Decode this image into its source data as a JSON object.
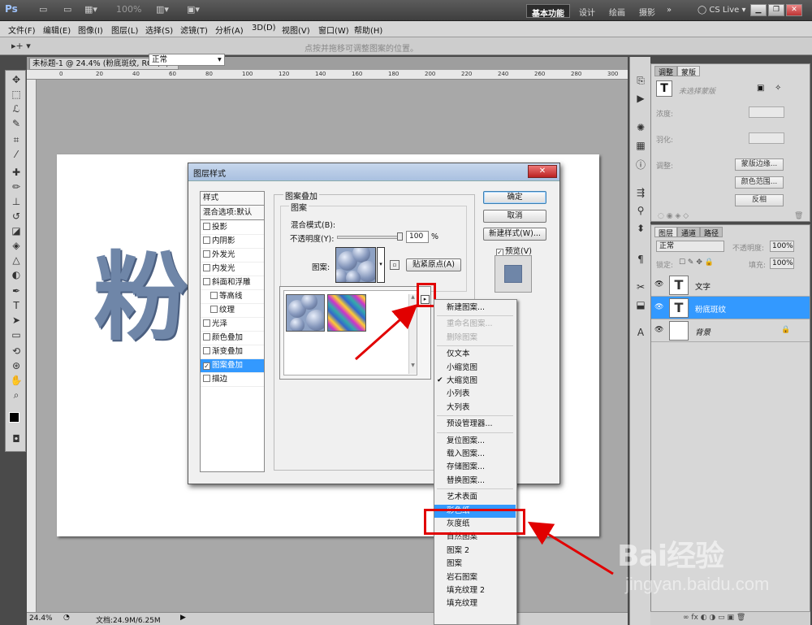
{
  "app": {
    "logo": "Ps",
    "zoom_dropdown": "100%",
    "workspaces": [
      "基本功能",
      "设计",
      "绘画",
      "摄影",
      "»"
    ],
    "cs_live": "CS Live"
  },
  "menus": [
    "文件(F)",
    "编辑(E)",
    "图像(I)",
    "图层(L)",
    "选择(S)",
    "滤镜(T)",
    "分析(A)",
    "3D(D)",
    "视图(V)",
    "窗口(W)",
    "帮助(H)"
  ],
  "options_bar": {
    "hint": "点按并拖移可调整图案的位置。"
  },
  "document": {
    "tab_title": "未标题-1 @ 24.4% (粉底斑纹, RGB/8) *",
    "ruler_ticks": [
      "0",
      "20",
      "40",
      "60",
      "80",
      "100",
      "120",
      "140",
      "160",
      "180",
      "200",
      "220",
      "240",
      "260",
      "280",
      "300"
    ],
    "canvas_text": "粉",
    "status_zoom": "24.4%",
    "status_doc": "文档:24.9M/6.25M"
  },
  "adjust_panel": {
    "tabs": [
      "调整",
      "蒙版"
    ],
    "no_mask": "未选择蒙版",
    "density": "浓度:",
    "feather": "羽化:",
    "refine": "调整:",
    "btn_edge": "蒙版边缘...",
    "btn_color_range": "颜色范围...",
    "btn_invert": "反相"
  },
  "layers_panel": {
    "tabs": [
      "图层",
      "通道",
      "路径"
    ],
    "blend": "正常",
    "opacity_label": "不透明度:",
    "opacity": "100%",
    "lock_label": "锁定:",
    "fill_label": "填充:",
    "fill": "100%",
    "layers": [
      {
        "name": "文字",
        "thumb": "T",
        "selected": false
      },
      {
        "name": "粉底斑纹",
        "thumb": "T",
        "selected": true
      },
      {
        "name": "背景",
        "thumb": "",
        "selected": false
      }
    ]
  },
  "dialog": {
    "title": "图层样式",
    "close": "✕",
    "styles": [
      {
        "label": "样式",
        "header": true
      },
      {
        "label": "混合选项:默认",
        "header": true
      },
      {
        "label": "投影",
        "checked": false
      },
      {
        "label": "内阴影",
        "checked": false
      },
      {
        "label": "外发光",
        "checked": false
      },
      {
        "label": "内发光",
        "checked": false
      },
      {
        "label": "斜面和浮雕",
        "checked": false
      },
      {
        "label": "等高线",
        "checked": false,
        "indent": true
      },
      {
        "label": "纹理",
        "checked": false,
        "indent": true
      },
      {
        "label": "光泽",
        "checked": false
      },
      {
        "label": "颜色叠加",
        "checked": false
      },
      {
        "label": "渐变叠加",
        "checked": false
      },
      {
        "label": "图案叠加",
        "checked": true,
        "selected": true
      },
      {
        "label": "描边",
        "checked": false
      }
    ],
    "group_title": "图案叠加",
    "sub_group": "图案",
    "blend_label": "混合模式(B):",
    "blend_value": "正常",
    "opacity_label": "不透明度(Y):",
    "opacity_value": "100",
    "opacity_unit": "%",
    "opacity_fraction": 1.0,
    "pattern_label": "图案:",
    "snap_btn": "贴紧原点(A)",
    "btn_ok": "确定",
    "btn_cancel": "取消",
    "btn_new_style": "新建样式(W)...",
    "preview_label": "预览(V)",
    "preview_checked": true
  },
  "context_menu": {
    "items": [
      {
        "label": "新建图案...",
        "disabled": false
      },
      {
        "sep": true
      },
      {
        "label": "重命名图案...",
        "disabled": true
      },
      {
        "label": "删除图案",
        "disabled": true
      },
      {
        "sep": true
      },
      {
        "label": "仅文本",
        "disabled": false
      },
      {
        "label": "小缩览图",
        "disabled": false
      },
      {
        "label": "大缩览图",
        "disabled": false,
        "checked": true
      },
      {
        "label": "小列表",
        "disabled": false
      },
      {
        "label": "大列表",
        "disabled": false
      },
      {
        "sep": true
      },
      {
        "label": "预设管理器...",
        "disabled": false
      },
      {
        "sep": true
      },
      {
        "label": "复位图案...",
        "disabled": false
      },
      {
        "label": "载入图案...",
        "disabled": false
      },
      {
        "label": "存储图案...",
        "disabled": false
      },
      {
        "label": "替换图案...",
        "disabled": false
      },
      {
        "sep": true
      },
      {
        "label": "艺术表面",
        "disabled": false
      },
      {
        "label": "彩色纸",
        "disabled": false,
        "selected": true
      },
      {
        "label": "灰度纸",
        "disabled": false
      },
      {
        "label": "自然图案",
        "disabled": false
      },
      {
        "label": "图案 2",
        "disabled": false
      },
      {
        "label": "图案",
        "disabled": false
      },
      {
        "label": "岩石图案",
        "disabled": false
      },
      {
        "label": "填充纹理 2",
        "disabled": false
      },
      {
        "label": "填充纹理",
        "disabled": false
      }
    ]
  },
  "watermark": {
    "brand": "Bai经验",
    "url": "jingyan.baidu.com"
  },
  "colors": {
    "accent": "#3399ff",
    "annotation_red": "#e10000",
    "text_fill": "#6f86a8"
  }
}
